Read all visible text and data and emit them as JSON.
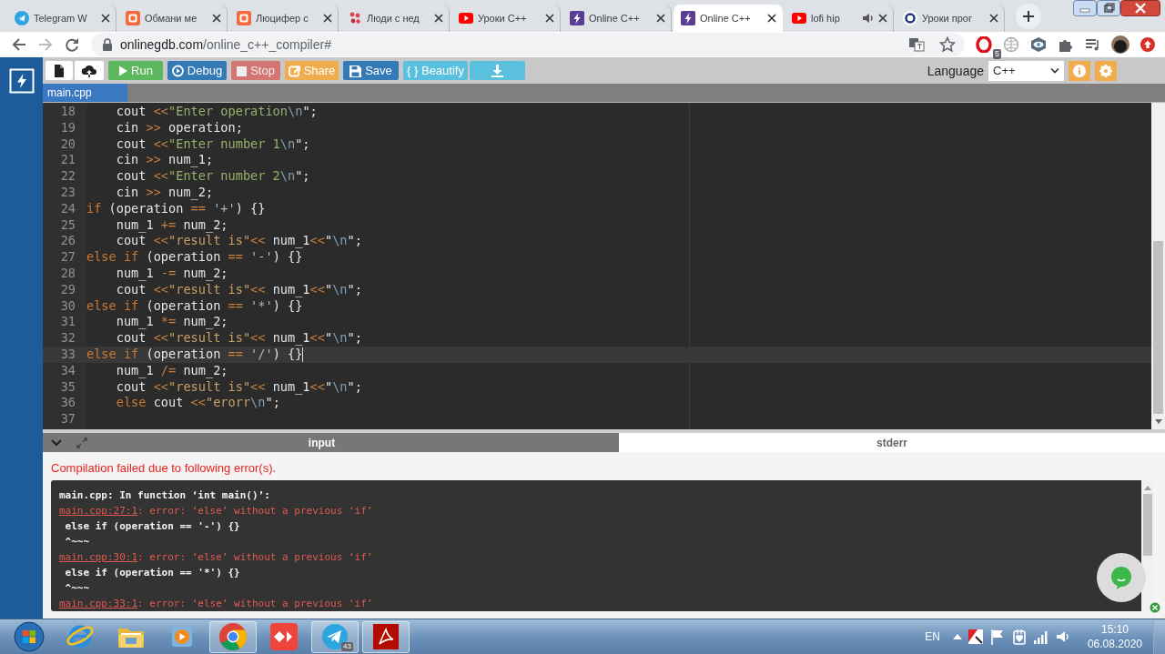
{
  "browser": {
    "tabs": [
      {
        "title": "Telegram W",
        "kind": "telegram",
        "selected": false,
        "audio": false
      },
      {
        "title": "Обмани ме",
        "kind": "square",
        "selected": false,
        "audio": false
      },
      {
        "title": "Люцифер с",
        "kind": "square",
        "selected": false,
        "audio": false
      },
      {
        "title": "Люди с нед",
        "kind": "hearts",
        "selected": false,
        "audio": false
      },
      {
        "title": "Уроки С++",
        "kind": "youtube",
        "selected": false,
        "audio": false
      },
      {
        "title": "Online C++",
        "kind": "bolt",
        "selected": false,
        "audio": false
      },
      {
        "title": "Online C++",
        "kind": "bolt",
        "selected": true,
        "audio": false
      },
      {
        "title": "lofi hip",
        "kind": "youtube",
        "selected": false,
        "audio": true
      },
      {
        "title": "Уроки прог",
        "kind": "ring",
        "selected": false,
        "audio": false
      }
    ],
    "url_host": "onlinegdb.com",
    "url_path": "/online_c++_compiler#",
    "extensions": [
      {
        "kind": "opera",
        "badge": "5"
      },
      {
        "kind": "globe"
      },
      {
        "kind": "eye"
      },
      {
        "kind": "puzzle"
      },
      {
        "kind": "media"
      },
      {
        "kind": "avatar"
      },
      {
        "kind": "update"
      }
    ]
  },
  "toolbar": {
    "buttons": [
      {
        "kind": "new",
        "disabled": false
      },
      {
        "kind": "upload",
        "disabled": false
      },
      {
        "kind": "run",
        "label": "Run",
        "disabled": false
      },
      {
        "kind": "debug",
        "label": "Debug",
        "disabled": false
      },
      {
        "kind": "stop",
        "label": "Stop",
        "disabled": true
      },
      {
        "kind": "share",
        "label": "Share",
        "disabled": false
      },
      {
        "kind": "save",
        "label": "Save",
        "disabled": false
      },
      {
        "kind": "beautify",
        "label": "{ } Beautify",
        "disabled": false
      },
      {
        "kind": "download",
        "disabled": false
      }
    ],
    "language_label": "Language",
    "language": "C++"
  },
  "file_tabs": [
    {
      "label": "main.cpp",
      "selected": true
    }
  ],
  "editor": {
    "lines": [
      {
        "number": "18",
        "active": false,
        "tokens": [
          {
            "text": "    cout ",
            "kind": "text"
          },
          {
            "text": "<<",
            "kind": "op"
          },
          {
            "text": "\"Enter operation",
            "kind": "str"
          },
          {
            "text": "\\n",
            "kind": "esc"
          },
          {
            "text": "\";",
            "kind": "text"
          }
        ]
      },
      {
        "number": "19",
        "active": false,
        "tokens": [
          {
            "text": "    cin ",
            "kind": "text"
          },
          {
            "text": ">>",
            "kind": "op"
          },
          {
            "text": " operation;",
            "kind": "text"
          }
        ]
      },
      {
        "number": "20",
        "active": false,
        "tokens": [
          {
            "text": "    cout ",
            "kind": "text"
          },
          {
            "text": "<<",
            "kind": "op"
          },
          {
            "text": "\"Enter number 1",
            "kind": "str"
          },
          {
            "text": "\\n",
            "kind": "esc"
          },
          {
            "text": "\";",
            "kind": "text"
          }
        ]
      },
      {
        "number": "21",
        "active": false,
        "tokens": [
          {
            "text": "    cin ",
            "kind": "text"
          },
          {
            "text": ">>",
            "kind": "op"
          },
          {
            "text": " num_1;",
            "kind": "text"
          }
        ]
      },
      {
        "number": "22",
        "active": false,
        "tokens": [
          {
            "text": "    cout ",
            "kind": "text"
          },
          {
            "text": "<<",
            "kind": "op"
          },
          {
            "text": "\"Enter number 2",
            "kind": "str"
          },
          {
            "text": "\\n",
            "kind": "esc"
          },
          {
            "text": "\";",
            "kind": "text"
          }
        ]
      },
      {
        "number": "23",
        "active": false,
        "tokens": [
          {
            "text": "    cin ",
            "kind": "text"
          },
          {
            "text": ">>",
            "kind": "op"
          },
          {
            "text": " num_2;",
            "kind": "text"
          }
        ]
      },
      {
        "number": "24",
        "active": false,
        "tokens": [
          {
            "text": "if",
            "kind": "kw"
          },
          {
            "text": " (operation ",
            "kind": "text"
          },
          {
            "text": "==",
            "kind": "op"
          },
          {
            "text": " '+'",
            "kind": "chr"
          },
          {
            "text": ") {}",
            "kind": "text"
          }
        ]
      },
      {
        "number": "25",
        "active": false,
        "tokens": [
          {
            "text": "    num_1 ",
            "kind": "text"
          },
          {
            "text": "+=",
            "kind": "op"
          },
          {
            "text": " num_2;",
            "kind": "text"
          }
        ]
      },
      {
        "number": "26",
        "active": false,
        "tokens": [
          {
            "text": "    cout ",
            "kind": "text"
          },
          {
            "text": "<<",
            "kind": "op"
          },
          {
            "text": "\"result is\"",
            "kind": "str2"
          },
          {
            "text": "<<",
            "kind": "op"
          },
          {
            "text": " num_1",
            "kind": "text"
          },
          {
            "text": "<<",
            "kind": "op"
          },
          {
            "text": "\"",
            "kind": "text"
          },
          {
            "text": "\\n",
            "kind": "esc"
          },
          {
            "text": "\";",
            "kind": "text"
          }
        ]
      },
      {
        "number": "27",
        "active": false,
        "tokens": [
          {
            "text": "else if",
            "kind": "kw"
          },
          {
            "text": " (operation ",
            "kind": "text"
          },
          {
            "text": "==",
            "kind": "op"
          },
          {
            "text": " '-'",
            "kind": "chr"
          },
          {
            "text": ") {}",
            "kind": "text"
          }
        ]
      },
      {
        "number": "28",
        "active": false,
        "tokens": [
          {
            "text": "    num_1 ",
            "kind": "text"
          },
          {
            "text": "-=",
            "kind": "op"
          },
          {
            "text": " num_2;",
            "kind": "text"
          }
        ]
      },
      {
        "number": "29",
        "active": false,
        "tokens": [
          {
            "text": "    cout ",
            "kind": "text"
          },
          {
            "text": "<<",
            "kind": "op"
          },
          {
            "text": "\"result is\"",
            "kind": "str2"
          },
          {
            "text": "<<",
            "kind": "op"
          },
          {
            "text": " num_1",
            "kind": "text"
          },
          {
            "text": "<<",
            "kind": "op"
          },
          {
            "text": "\"",
            "kind": "text"
          },
          {
            "text": "\\n",
            "kind": "esc"
          },
          {
            "text": "\";",
            "kind": "text"
          }
        ]
      },
      {
        "number": "30",
        "active": false,
        "tokens": [
          {
            "text": "else if",
            "kind": "kw"
          },
          {
            "text": " (operation ",
            "kind": "text"
          },
          {
            "text": "==",
            "kind": "op"
          },
          {
            "text": " '*'",
            "kind": "chr"
          },
          {
            "text": ") {}",
            "kind": "text"
          }
        ]
      },
      {
        "number": "31",
        "active": false,
        "tokens": [
          {
            "text": "    num_1 ",
            "kind": "text"
          },
          {
            "text": "*=",
            "kind": "op"
          },
          {
            "text": " num_2;",
            "kind": "text"
          }
        ]
      },
      {
        "number": "32",
        "active": false,
        "tokens": [
          {
            "text": "    cout ",
            "kind": "text"
          },
          {
            "text": "<<",
            "kind": "op"
          },
          {
            "text": "\"result is\"",
            "kind": "str2"
          },
          {
            "text": "<<",
            "kind": "op"
          },
          {
            "text": " num_1",
            "kind": "text"
          },
          {
            "text": "<<",
            "kind": "op"
          },
          {
            "text": "\"",
            "kind": "text"
          },
          {
            "text": "\\n",
            "kind": "esc"
          },
          {
            "text": "\";",
            "kind": "text"
          }
        ]
      },
      {
        "number": "33",
        "active": true,
        "tokens": [
          {
            "text": "else if",
            "kind": "kw"
          },
          {
            "text": " (operation ",
            "kind": "text"
          },
          {
            "text": "==",
            "kind": "op"
          },
          {
            "text": " '/'",
            "kind": "chr"
          },
          {
            "text": ") {}",
            "kind": "text"
          }
        ]
      },
      {
        "number": "34",
        "active": false,
        "tokens": [
          {
            "text": "    num_1 ",
            "kind": "text"
          },
          {
            "text": "/=",
            "kind": "op"
          },
          {
            "text": " num_2;",
            "kind": "text"
          }
        ]
      },
      {
        "number": "35",
        "active": false,
        "tokens": [
          {
            "text": "    cout ",
            "kind": "text"
          },
          {
            "text": "<<",
            "kind": "op"
          },
          {
            "text": "\"result is\"",
            "kind": "str2"
          },
          {
            "text": "<<",
            "kind": "op"
          },
          {
            "text": " num_1",
            "kind": "text"
          },
          {
            "text": "<<",
            "kind": "op"
          },
          {
            "text": "\"",
            "kind": "text"
          },
          {
            "text": "\\n",
            "kind": "esc"
          },
          {
            "text": "\";",
            "kind": "text"
          }
        ]
      },
      {
        "number": "36",
        "active": false,
        "tokens": [
          {
            "text": "    else",
            "kind": "kw"
          },
          {
            "text": " cout ",
            "kind": "text"
          },
          {
            "text": "<<",
            "kind": "op"
          },
          {
            "text": "\"erorr",
            "kind": "str2"
          },
          {
            "text": "\\n",
            "kind": "esc"
          },
          {
            "text": "\";",
            "kind": "text"
          }
        ]
      },
      {
        "number": "37",
        "active": false
      }
    ]
  },
  "panel": {
    "tabs": [
      {
        "label": "input",
        "selected": false
      },
      {
        "label": "stderr",
        "selected": true
      }
    ],
    "message": "Compilation failed due to following error(s).",
    "output": [
      {
        "kind": "plain",
        "text": "main.cpp: In function ‘int main()’:"
      },
      {
        "kind": "error",
        "link": "main.cpp:27:1",
        "text": ": error: ‘else’ without a previous ‘if’"
      },
      {
        "kind": "plain",
        "text": " else if (operation == '-') {}"
      },
      {
        "kind": "plain",
        "text": " ^~~~"
      },
      {
        "kind": "error",
        "link": "main.cpp:30:1",
        "text": ": error: ‘else’ without a previous ‘if’"
      },
      {
        "kind": "plain",
        "text": " else if (operation == '*') {}"
      },
      {
        "kind": "plain",
        "text": " ^~~~"
      },
      {
        "kind": "error",
        "link": "main.cpp:33:1",
        "text": ": error: ‘else’ without a previous ‘if’"
      }
    ]
  },
  "taskbar": {
    "items": [
      {
        "kind": "start",
        "running": false
      },
      {
        "kind": "ie",
        "running": false
      },
      {
        "kind": "folder",
        "running": false
      },
      {
        "kind": "media",
        "running": false
      },
      {
        "kind": "chrome",
        "running": true
      },
      {
        "kind": "anydesk",
        "running": false
      },
      {
        "kind": "telegram",
        "running": true,
        "badge": "43"
      },
      {
        "kind": "acrobat",
        "running": true
      }
    ],
    "language": "EN",
    "time": "15:10",
    "date": "06.08.2020"
  }
}
